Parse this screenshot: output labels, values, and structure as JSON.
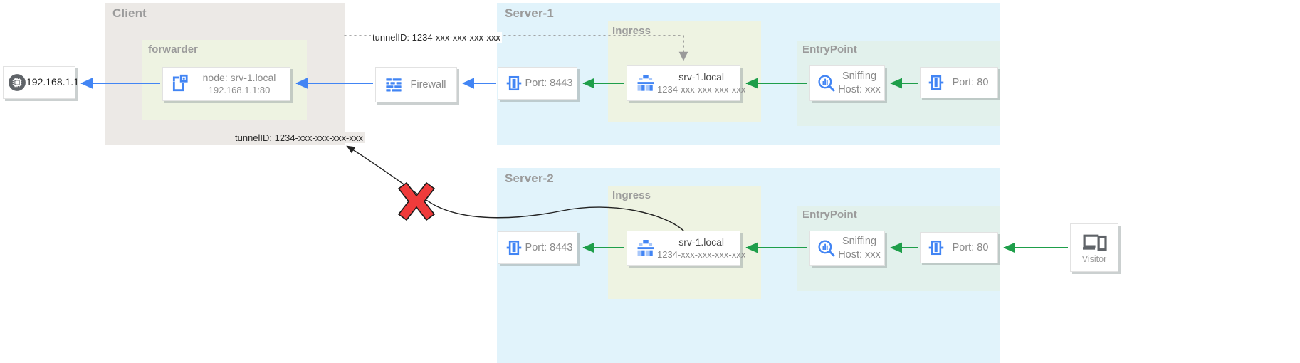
{
  "diagram": {
    "title_groups": {
      "client": "Client",
      "forwarder": "forwarder",
      "server1": "Server-1",
      "server2": "Server-2",
      "ingress1": "Ingress",
      "ingress2": "Ingress",
      "entrypoint1": "EntryPoint",
      "entrypoint2": "EntryPoint"
    },
    "labels": {
      "tunnel_top": "tunnelID: 1234-xxx-xxx-xxx-xxx",
      "tunnel_client": "tunnelID: 1234-xxx-xxx-xxx-xxx"
    },
    "nodes": {
      "host": {
        "label": "192.168.1.1",
        "icon": "cpu-chip-icon"
      },
      "forwarder": {
        "line1": "node: srv-1.local",
        "line2": "192.168.1.1:80",
        "icon": "container-node-icon"
      },
      "firewall": {
        "label": "Firewall",
        "icon": "firewall-brick-icon"
      },
      "s1_port_8443": {
        "label": "Port: 8443",
        "icon": "port-plug-icon"
      },
      "s1_ingress": {
        "line1": "srv-1.local",
        "line2": "1234-xxx-xxx-xxx-xxx",
        "icon": "ingress-tree-icon"
      },
      "s1_sniffing": {
        "line1": "Sniffing",
        "line2": "Host: xxx",
        "icon": "magnifier-analytics-icon"
      },
      "s1_port_80": {
        "label": "Port: 80",
        "icon": "port-plug-icon"
      },
      "s2_port_8443": {
        "label": "Port: 8443",
        "icon": "port-plug-icon"
      },
      "s2_ingress": {
        "line1": "srv-1.local",
        "line2": "1234-xxx-xxx-xxx-xxx",
        "icon": "ingress-tree-icon"
      },
      "s2_sniffing": {
        "line1": "Sniffing",
        "line2": "Host: xxx",
        "icon": "magnifier-analytics-icon"
      },
      "s2_port_80": {
        "label": "Port: 80",
        "icon": "port-plug-icon"
      },
      "visitor": {
        "label": "Visitor",
        "icon": "devices-laptop-phone-icon"
      }
    },
    "markers": {
      "blocked": {
        "icon": "red-x-blocked-icon",
        "color": "#ef3b3b"
      }
    },
    "colors": {
      "client_bg": "#ece9e6",
      "server_bg": "#e1f3fb",
      "ingress_bg": "#eef3e2",
      "entrypoint_bg": "#e2f1ec",
      "arrow_blue": "#4285f4",
      "arrow_green": "#1e9e4a",
      "arrow_black": "#222222",
      "icon_blue": "#4285f4",
      "group_title": "#9b9b9b",
      "node_border": "#e2e2e2"
    }
  }
}
